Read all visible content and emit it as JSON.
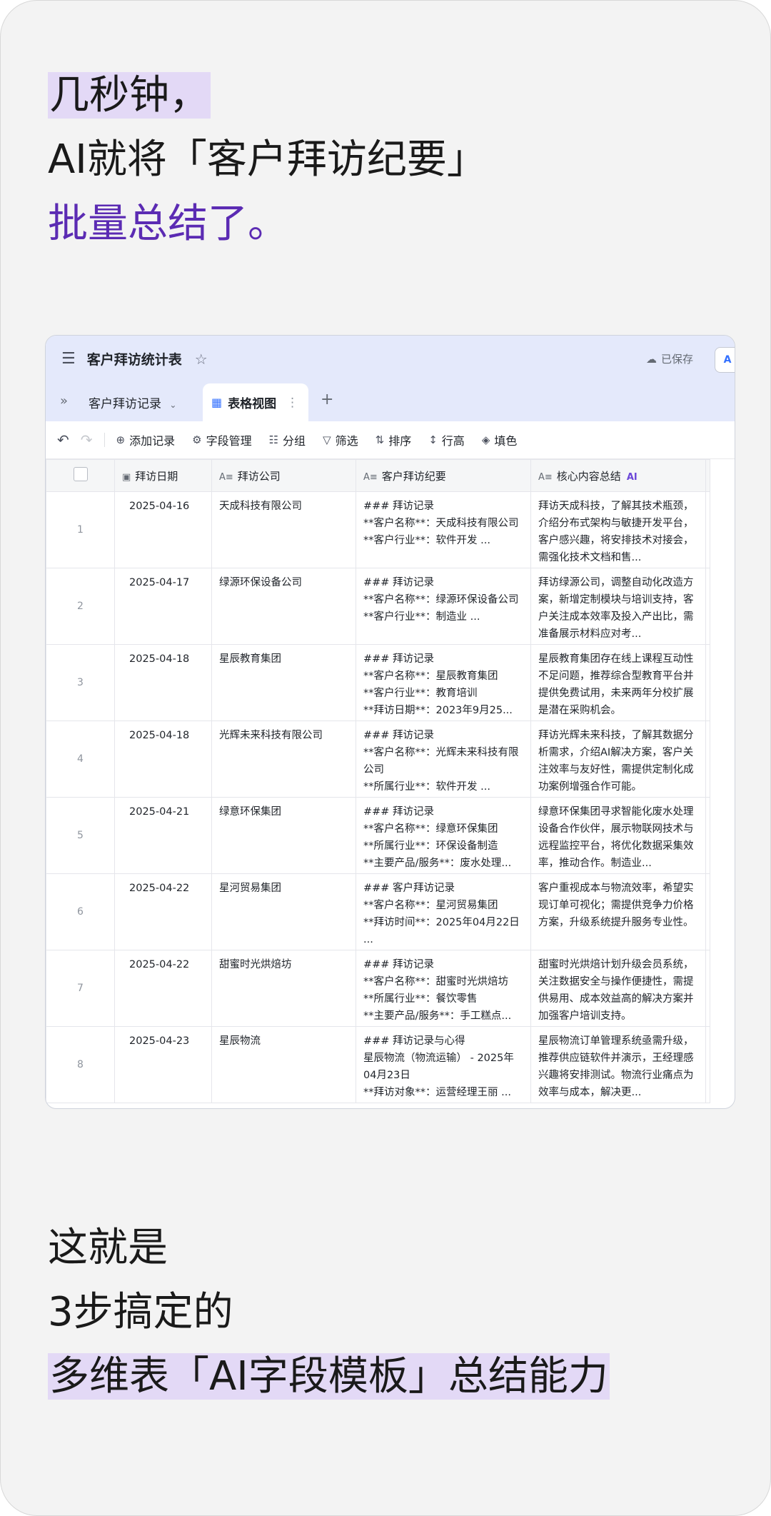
{
  "headline": {
    "line1": "几秒钟，",
    "line2": "AI就将「客户拜访纪要」",
    "line3": "批量总结了。"
  },
  "app": {
    "title": "客户拜访统计表",
    "saved": "已保存",
    "table_tab": "客户拜访记录",
    "view_tab": "表格视图",
    "toolbar": {
      "add": "添加记录",
      "fields": "字段管理",
      "group": "分组",
      "filter": "筛选",
      "sort": "排序",
      "row_height": "行高",
      "fill": "填色"
    },
    "columns": {
      "date": "拜访日期",
      "company": "拜访公司",
      "notes": "客户拜访纪要",
      "summary": "核心内容总结",
      "ai_badge": "AI"
    },
    "rows": [
      {
        "n": "1",
        "date": "2025-04-16",
        "company": "天成科技有限公司",
        "notes": "### 拜访记录\n**客户名称**：天成科技有限公司\n**客户行业**：软件开发 ...",
        "summary": "拜访天成科技，了解其技术瓶颈，介绍分布式架构与敏捷开发平台，客户感兴趣，将安排技术对接会，需强化技术文档和售..."
      },
      {
        "n": "2",
        "date": "2025-04-17",
        "company": "绿源环保设备公司",
        "notes": "### 拜访记录\n**客户名称**：绿源环保设备公司\n**客户行业**：制造业 ...",
        "summary": "拜访绿源公司，调整自动化改造方案，新增定制模块与培训支持，客户关注成本效率及投入产出比，需准备展示材料应对考..."
      },
      {
        "n": "3",
        "date": "2025-04-18",
        "company": "星辰教育集团",
        "notes": "### 拜访记录\n**客户名称**：星辰教育集团\n**客户行业**：教育培训\n**拜访日期**：2023年9月25...",
        "summary": "星辰教育集团存在线上课程互动性不足问题，推荐综合型教育平台并提供免费试用，未来两年分校扩展是潜在采购机会。"
      },
      {
        "n": "4",
        "date": "2025-04-18",
        "company": "光辉未来科技有限公司",
        "notes": "### 拜访记录\n**客户名称**：光辉未来科技有限公司\n**所属行业**：软件开发 ...",
        "summary": "拜访光辉未来科技，了解其数据分析需求，介绍AI解决方案，客户关注效率与友好性，需提供定制化成功案例增强合作可能。"
      },
      {
        "n": "5",
        "date": "2025-04-21",
        "company": "绿意环保集团",
        "notes": "### 拜访记录\n**客户名称**：绿意环保集团\n**所属行业**：环保设备制造\n**主要产品/服务**：废水处理...",
        "summary": "绿意环保集团寻求智能化废水处理设备合作伙伴，展示物联网技术与远程监控平台，将优化数据采集效率，推动合作。制造业..."
      },
      {
        "n": "6",
        "date": "2025-04-22",
        "company": "星河贸易集团",
        "notes": "### 客户拜访记录\n**客户名称**：星河贸易集团\n**拜访时间**：2025年04月22日 ...",
        "summary": "客户重视成本与物流效率，希望实现订单可视化；需提供竞争力价格方案，升级系统提升服务专业性。"
      },
      {
        "n": "7",
        "date": "2025-04-22",
        "company": "甜蜜时光烘焙坊",
        "notes": "### 拜访记录\n**客户名称**：甜蜜时光烘焙坊\n**所属行业**：餐饮零售\n**主要产品/服务**：手工糕点...",
        "summary": "甜蜜时光烘焙计划升级会员系统，关注数据安全与操作便捷性，需提供易用、成本效益高的解决方案并加强客户培训支持。"
      },
      {
        "n": "8",
        "date": "2025-04-23",
        "company": "星辰物流",
        "notes": "### 拜访记录与心得\n星辰物流（物流运输） - 2025年04月23日\n**拜访对象**：运营经理王丽 ...",
        "summary": "星辰物流订单管理系统亟需升级，推荐供应链软件并演示，王经理感兴趣将安排测试。物流行业痛点为效率与成本，解决更..."
      }
    ]
  },
  "footer": {
    "line1": "这就是",
    "line2": "3步搞定的",
    "line3": "多维表「AI字段模板」总结能力"
  }
}
